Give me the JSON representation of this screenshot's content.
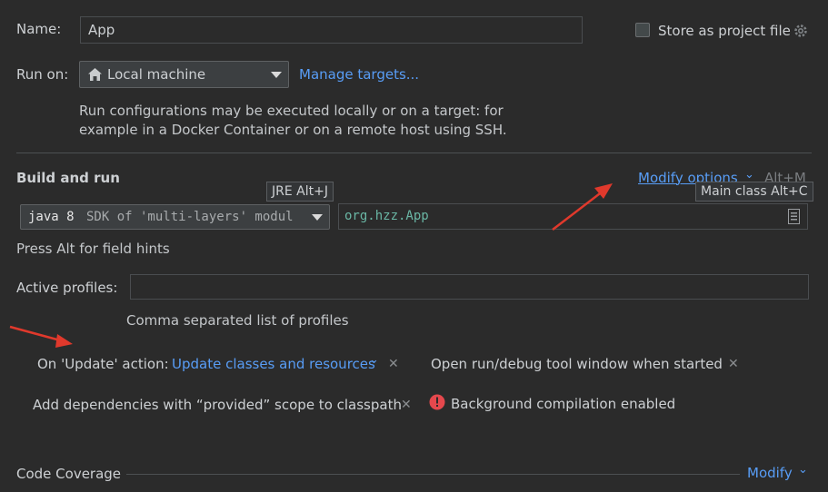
{
  "name_row": {
    "label": "Name:",
    "value": "App"
  },
  "store": {
    "label": "Store as project file"
  },
  "run_on": {
    "label": "Run on:",
    "target": "Local machine",
    "manage_link": "Manage targets...",
    "help_line1": "Run configurations may be executed locally or on a target: for",
    "help_line2": "example in a Docker Container or on a remote host using SSH."
  },
  "build": {
    "title": "Build and run",
    "modify_options": "Modify options",
    "modify_shortcut": "Alt+M",
    "jre_tooltip": "JRE Alt+J",
    "main_class_tooltip": "Main class Alt+C",
    "sdk_main": "java 8",
    "sdk_sub": "SDK of 'multi-layers' modul",
    "main_class": "org.hzz.App",
    "hint": "Press Alt for field hints"
  },
  "profiles": {
    "label": "Active profiles:",
    "value": "",
    "hint": "Comma separated list of profiles"
  },
  "options": {
    "on_update_label": "On 'Update' action:",
    "on_update_value": "Update classes and resources",
    "open_tool_window": "Open run/debug tool window when started",
    "add_deps": "Add dependencies with “provided” scope to classpath",
    "background_compilation": "Background compilation enabled"
  },
  "coverage": {
    "title": "Code Coverage",
    "modify": "Modify"
  },
  "colors": {
    "background": "#2b2b2b",
    "link": "#589df6",
    "arrow": "#e0392c",
    "error": "#e5484d",
    "main_class_text": "#6ab7a5"
  }
}
